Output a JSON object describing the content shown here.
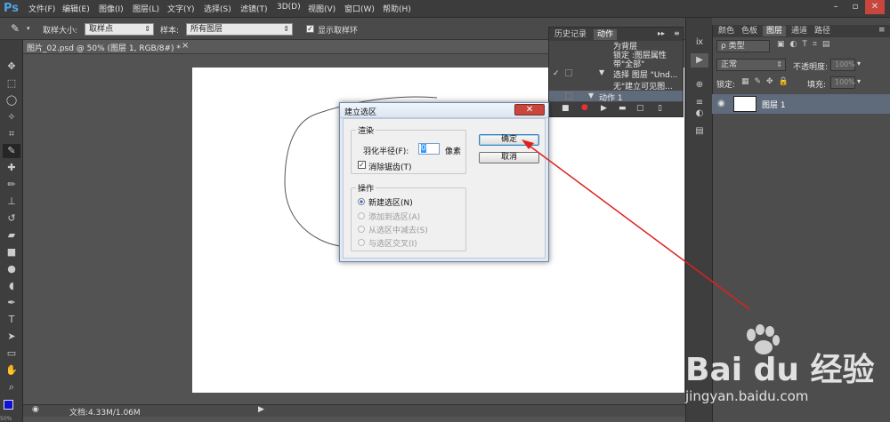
{
  "app": {
    "logo": "Ps"
  },
  "menubar": {
    "items": [
      "文件(F)",
      "编辑(E)",
      "图像(I)",
      "图层(L)",
      "文字(Y)",
      "选择(S)",
      "滤镜(T)",
      "3D(D)",
      "视图(V)",
      "窗口(W)",
      "帮助(H)"
    ]
  },
  "window_buttons": [
    "–",
    "▫",
    "✕"
  ],
  "options": {
    "sample_size_label": "取样大小:",
    "sample_size_value": "取样点",
    "sample_label": "样本:",
    "sample_value": "所有图层",
    "show_ring_label": "显示取样环"
  },
  "document": {
    "tab_title": "图片_02.psd @ 50% (图层 1, RGB/8#) *",
    "close": "×"
  },
  "status": {
    "doc_size": "文档:4.33M/1.06M",
    "zoom_partial": "50%"
  },
  "actions_panel": {
    "tabs": [
      "历史记录",
      "动作"
    ],
    "active_tab": "动作",
    "rows": [
      "为背层",
      "锁定 :图层属性",
      "带\"全部\"",
      "选择 图层 \"Und...",
      "无\"建立可见图...",
      "动作 1"
    ]
  },
  "layers_panel": {
    "tabs": [
      "颜色",
      "色板",
      "图层",
      "通道",
      "路径"
    ],
    "active_tab": "图层",
    "filter_label": "ρ 类型",
    "blend_mode": "正常",
    "opacity_label": "不透明度:",
    "opacity_value": "100%",
    "lock_label": "锁定:",
    "fill_label": "填充:",
    "fill_value": "100%",
    "layer_name": "图层 1"
  },
  "dialog": {
    "title": "建立选区",
    "close": "✕",
    "render_group": "渲染",
    "feather_label": "羽化半径(F):",
    "feather_value": "0",
    "feather_unit": "像素",
    "antialias_label": "消除锯齿(T)",
    "antialias_checked": true,
    "operation_group": "操作",
    "options": [
      {
        "label": "新建选区(N)",
        "selected": true,
        "enabled": true
      },
      {
        "label": "添加到选区(A)",
        "selected": false,
        "enabled": false
      },
      {
        "label": "从选区中减去(S)",
        "selected": false,
        "enabled": false
      },
      {
        "label": "与选区交叉(I)",
        "selected": false,
        "enabled": false
      }
    ],
    "ok_label": "确定",
    "cancel_label": "取消"
  },
  "watermark": {
    "brand": "Bai du 经验",
    "url": "jingyan.baidu.com"
  },
  "colors": {
    "annotation_arrow": "#e02020",
    "selection_bg": "#5f6b7a"
  }
}
